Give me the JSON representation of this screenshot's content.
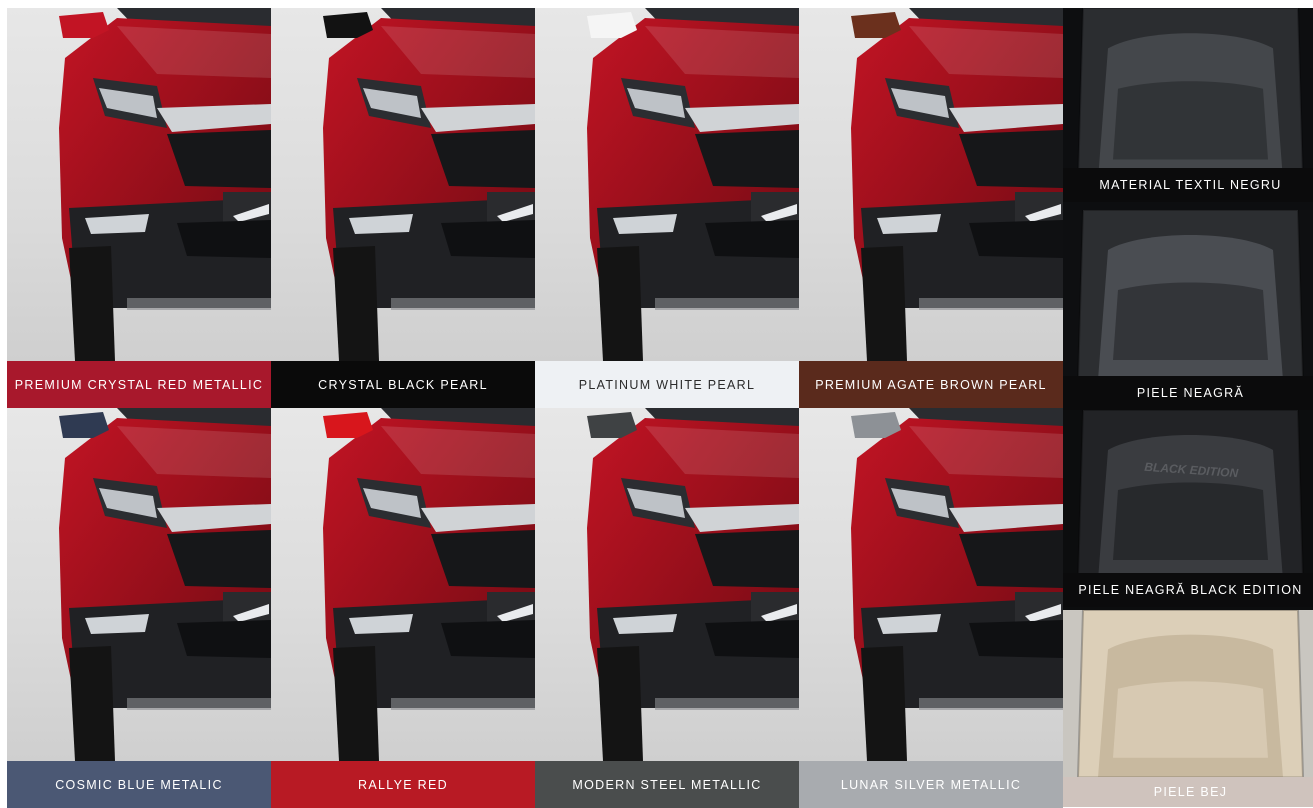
{
  "exterior_colors": [
    {
      "label": "PREMIUM CRYSTAL RED METALLIC",
      "swatch": "#a8182c",
      "text": "#ffffff",
      "body": "#c21424",
      "body_dark": "#6d0a12",
      "mirror": "#c21424"
    },
    {
      "label": "CRYSTAL BLACK PEARL",
      "swatch": "#0a0a0a",
      "text": "#ffffff",
      "body": "#141414",
      "body_dark": "#050505",
      "mirror": "#121212"
    },
    {
      "label": "PLATINUM WHITE PEARL",
      "swatch": "#eef1f4",
      "text": "#2b2b2b",
      "body": "#f3f3f1",
      "body_dark": "#c9cac8",
      "mirror": "#f5f5f5"
    },
    {
      "label": "PREMIUM AGATE BROWN PEARL",
      "swatch": "#5a2a1c",
      "text": "#ffffff",
      "body": "#6b301d",
      "body_dark": "#3a170c",
      "mirror": "#6b301d"
    },
    {
      "label": "COSMIC BLUE METALIC",
      "swatch": "#4b5874",
      "text": "#ffffff",
      "body": "#2f3a52",
      "body_dark": "#151b28",
      "mirror": "#2f3a52"
    },
    {
      "label": "RALLYE RED",
      "swatch": "#b81a24",
      "text": "#ffffff",
      "body": "#d8161c",
      "body_dark": "#7c080c",
      "mirror": "#d8161c"
    },
    {
      "label": "MODERN STEEL METALLIC",
      "swatch": "#4a4d4d",
      "text": "#ffffff",
      "body": "#3f4244",
      "body_dark": "#1d1f20",
      "mirror": "#3f4244"
    },
    {
      "label": "LUNAR SILVER METALLIC",
      "swatch": "#a8abaf",
      "text": "#ffffff",
      "body": "#8d9196",
      "body_dark": "#54575b",
      "mirror": "#8d9196"
    }
  ],
  "interior_trims": [
    {
      "label": "MATERIAL TEXTIL NEGRU",
      "seat": "#2b2d30",
      "accent": "#44474b",
      "bg": "#0d0e10",
      "text": "#ffffff"
    },
    {
      "label": "PIELE NEAGRĂ",
      "seat": "#2c2e31",
      "accent": "#4a4d52",
      "bg": "#0e0f11",
      "text": "#ffffff"
    },
    {
      "label": "PIELE NEAGRĂ BLACK EDITION",
      "seat": "#222326",
      "accent": "#3a3c40",
      "bg": "#0c0d0e",
      "text": "#ffffff",
      "embroidery": "BLACK EDITION"
    },
    {
      "label": "PIELE BEJ",
      "seat": "#dccfb8",
      "accent": "#c8b99f",
      "bg": "#c9c6c0",
      "text": "#ffffff",
      "label_bg": "#cfc3bd"
    }
  ]
}
